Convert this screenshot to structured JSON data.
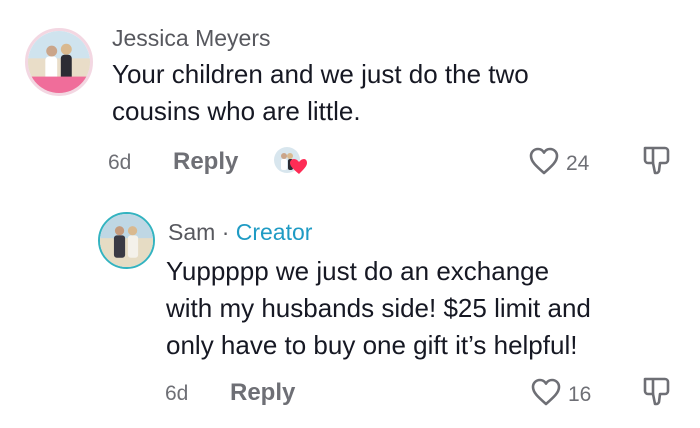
{
  "comments": [
    {
      "author": "Jessica Meyers",
      "text_line1": "Your children and we just do the two",
      "text_line2": "cousins who are little.",
      "time": "6d",
      "reply_label": "Reply",
      "like_count": "24",
      "avatar_icon": "profile-photo-couple-beach",
      "liked_by_icon": "creator-liked-heart-icon"
    },
    {
      "author": "Sam",
      "separator": "·",
      "badge": "Creator",
      "text_line1": "Yuppppp we just do an exchange",
      "text_line2": "with my husbands side! $25 limit and",
      "text_line3": "only have to buy one gift it’s helpful!",
      "time": "6d",
      "reply_label": "Reply",
      "like_count": "16",
      "avatar_icon": "profile-photo-couple-beach"
    }
  ],
  "colors": {
    "creator_accent": "#1f9bc4",
    "heart_red": "#fe2c55",
    "muted_text": "#6e6f75"
  }
}
